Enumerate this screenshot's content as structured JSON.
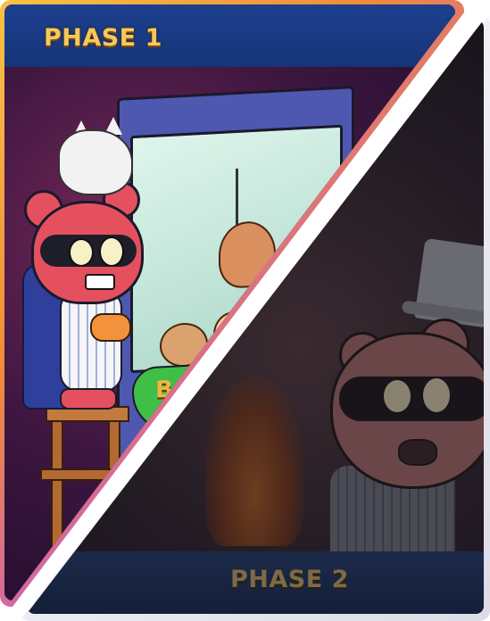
{
  "phase1": {
    "title": "PHASE 1",
    "machine_sign": "BAK"
  },
  "phase2": {
    "title": "PHASE 2"
  },
  "colors": {
    "header_blue": "#1d3f8e",
    "title_gold": "#f7c958",
    "frame_gradient_start": "#f6c344",
    "frame_gradient_end": "#6a3cf0",
    "phase2_title_dim": "#7e6a44"
  }
}
